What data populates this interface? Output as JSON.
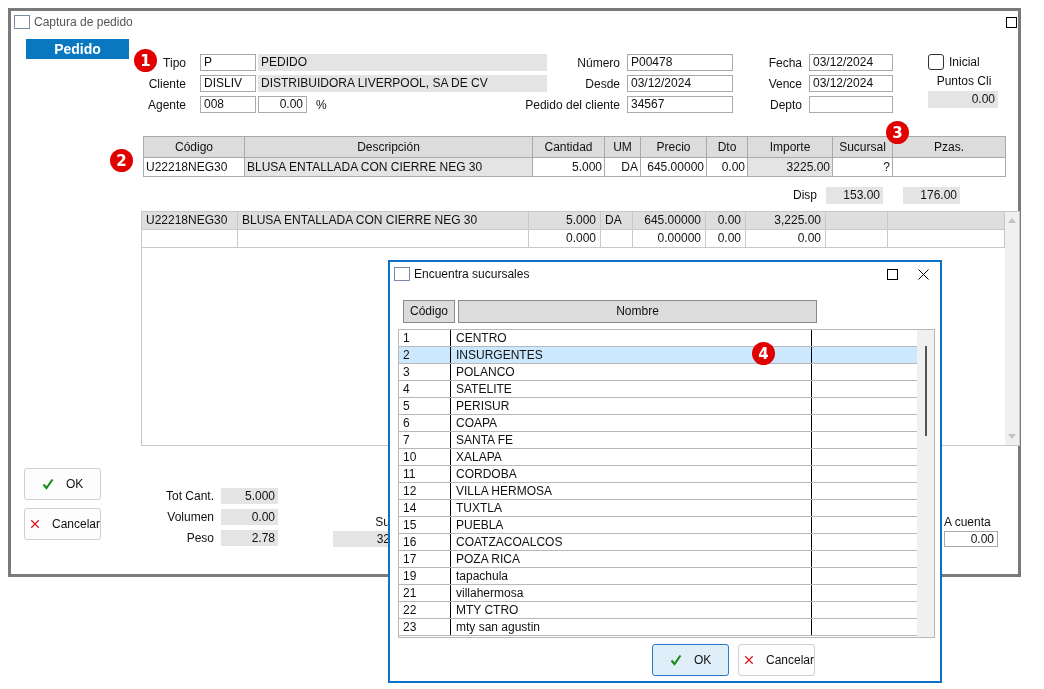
{
  "window": {
    "title": "Captura de pedido"
  },
  "section_tab": {
    "label": "Pedido"
  },
  "header": {
    "callout": "1",
    "left": [
      {
        "label": "Tipo",
        "code": "P",
        "name": "PEDIDO"
      },
      {
        "label": "Cliente",
        "code": "DISLIV",
        "name": "DISTRIBUIDORA LIVERPOOL, SA DE CV"
      },
      {
        "label": "Agente",
        "code": "008",
        "percent": "0.00",
        "unit": "%"
      }
    ],
    "middle": [
      {
        "label": "Número",
        "value": "P00478"
      },
      {
        "label": "Desde",
        "value": "03/12/2024"
      },
      {
        "label": "Pedido del cliente",
        "value": "34567"
      }
    ],
    "right": [
      {
        "label": "Fecha",
        "value": "03/12/2024"
      },
      {
        "label": "Vence",
        "value": "03/12/2024"
      },
      {
        "label": "Depto"
      }
    ],
    "inicial": {
      "label": "Inicial",
      "checked": false
    },
    "puntos": {
      "label": "Puntos Cli",
      "value": "0.00"
    }
  },
  "entry_grid": {
    "callout": "2",
    "sucursal_callout": "3",
    "columns": [
      {
        "label": "Código",
        "readonly": false
      },
      {
        "label": "Descripción",
        "readonly": true
      },
      {
        "label": "Cantidad",
        "readonly": false
      },
      {
        "label": "UM",
        "readonly": false
      },
      {
        "label": "Precio",
        "readonly": false
      },
      {
        "label": "Dto",
        "readonly": false
      },
      {
        "label": "Importe",
        "readonly": true
      },
      {
        "label": "Sucursal",
        "readonly": false
      },
      {
        "label": "Pzas.",
        "readonly": false
      }
    ],
    "row": {
      "codigo": "U22218NEG30",
      "descripcion": "BLUSA ENTALLADA CON CIERRE NEG 30",
      "cantidad": "5.000",
      "um": "DA",
      "precio": "645.00000",
      "dto": "0.00",
      "importe": "3225.00",
      "sucursal": "?"
    }
  },
  "disp": {
    "label": "Disp",
    "values": [
      "153.00",
      "176.00"
    ]
  },
  "lines": {
    "rows": [
      {
        "selected": true,
        "cells": {
          "codigo": "U22218NEG30",
          "descripcion": "BLUSA ENTALLADA CON CIERRE NEG 30",
          "cantidad": "5.000",
          "um": "DA",
          "precio": "645.00000",
          "dto": "0.00",
          "importe": "3,225.00"
        }
      },
      {
        "selected": false,
        "cells": {
          "cantidad": "0.000",
          "precio": "0.00000",
          "dto": "0.00",
          "importe": "0.00"
        }
      }
    ]
  },
  "buttons": [
    {
      "label": "OK",
      "kind": "ok"
    },
    {
      "label": "Cancelar",
      "kind": "cancel"
    }
  ],
  "totals": [
    {
      "label": "Tot Cant.",
      "value": "5.000"
    },
    {
      "label": "Volumen",
      "value": "0.00"
    },
    {
      "label": "Peso",
      "value": "2.78"
    }
  ],
  "subtotal": {
    "label": "Su",
    "value": "32"
  },
  "a_cuenta": {
    "label": "A cuenta",
    "value": "0.00"
  },
  "dialog": {
    "title": "Encuentra sucursales",
    "callout": "4",
    "columns": [
      "Código",
      "Nombre"
    ],
    "rows": [
      {
        "code": "1",
        "name": "CENTRO",
        "selected": false
      },
      {
        "code": "2",
        "name": "INSURGENTES",
        "selected": true
      },
      {
        "code": "3",
        "name": "POLANCO",
        "selected": false
      },
      {
        "code": "4",
        "name": "SATELITE",
        "selected": false
      },
      {
        "code": "5",
        "name": "PERISUR",
        "selected": false
      },
      {
        "code": "6",
        "name": "COAPA",
        "selected": false
      },
      {
        "code": "7",
        "name": "SANTA FE",
        "selected": false
      },
      {
        "code": "10",
        "name": "XALAPA",
        "selected": false
      },
      {
        "code": "11",
        "name": "CORDOBA",
        "selected": false
      },
      {
        "code": "12",
        "name": "VILLA HERMOSA",
        "selected": false
      },
      {
        "code": "14",
        "name": "TUXTLA",
        "selected": false
      },
      {
        "code": "15",
        "name": "PUEBLA",
        "selected": false
      },
      {
        "code": "16",
        "name": "COATZACOALCOS",
        "selected": false
      },
      {
        "code": "17",
        "name": "POZA RICA",
        "selected": false
      },
      {
        "code": "19",
        "name": "tapachula",
        "selected": false
      },
      {
        "code": "21",
        "name": "villahermosa",
        "selected": false
      },
      {
        "code": "22",
        "name": "MTY CTRO",
        "selected": false
      },
      {
        "code": "23",
        "name": "mty san agustin",
        "selected": false
      }
    ],
    "buttons": [
      {
        "label": "OK",
        "kind": "ok",
        "focused": true
      },
      {
        "label": "Cancelar",
        "kind": "cancel",
        "focused": false
      }
    ]
  }
}
